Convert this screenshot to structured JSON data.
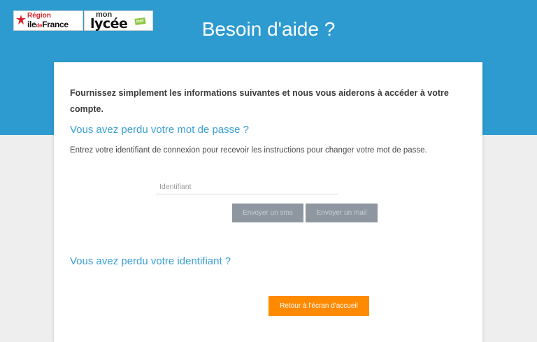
{
  "header": {
    "logo_region": {
      "line1": "Région",
      "line2_a": "ile",
      "line2_b": "de",
      "line2_c": "France"
    },
    "logo_lycee": {
      "line1": "mon",
      "line2": "lycée",
      "badge": "net"
    },
    "title": "Besoin d'aide ?"
  },
  "card": {
    "intro": "Fournissez simplement les informations suivantes et nous vous aiderons à accéder à votre compte.",
    "password_section": {
      "title": "Vous avez perdu votre mot de passe ?",
      "instructions": "Entrez votre identifiant de connexion pour recevoir les instructions pour changer votre mot de passe.",
      "input_placeholder": "Identifiant",
      "input_value": "",
      "sms_button": "Envoyer un sms",
      "mail_button": "Envoyer un mail"
    },
    "identifier_section": {
      "title": "Vous avez perdu votre identifiant ?"
    },
    "home_button": "Retour à l'écran d'accueil"
  },
  "colors": {
    "header_blue": "#2d9bd0",
    "link_blue": "#3a9fd5",
    "orange": "#ff8a00",
    "grey_button": "#8e96a0"
  }
}
